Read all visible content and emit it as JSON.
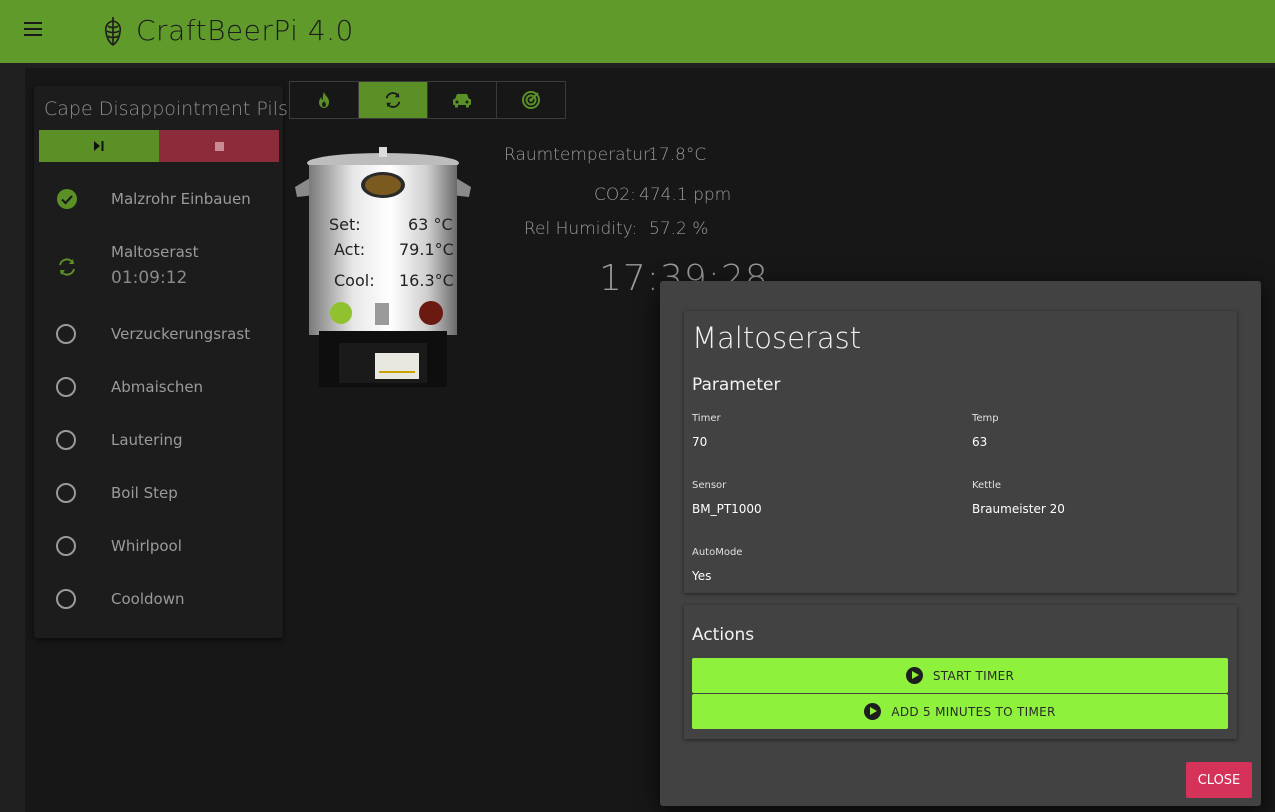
{
  "app": {
    "title": "CraftBeerPi 4.0"
  },
  "recipe": {
    "name": "Cape Disappointment Pils"
  },
  "steps": [
    {
      "label": "Malzrohr Einbauen",
      "status": "done"
    },
    {
      "label": "Maltoserast",
      "status": "active",
      "timer": "01:09:12"
    },
    {
      "label": "Verzuckerungsrast",
      "status": "pending"
    },
    {
      "label": "Abmaischen",
      "status": "pending"
    },
    {
      "label": "Lautering",
      "status": "pending"
    },
    {
      "label": "Boil Step",
      "status": "pending"
    },
    {
      "label": "Whirlpool",
      "status": "pending"
    },
    {
      "label": "Cooldown",
      "status": "pending"
    }
  ],
  "toolbar": {
    "icons": [
      "fire-icon",
      "sync-icon",
      "car-icon",
      "radar-icon"
    ],
    "active_index": 1
  },
  "kettle": {
    "set_label": "Set:",
    "set_value": "63 °C",
    "act_label": "Act:",
    "act_value": "79.1°C",
    "cool_label": "Cool:",
    "cool_value": "16.3°C"
  },
  "sensors": {
    "room_label": "Raumtemperatur:",
    "room_value": "17.8°C",
    "co2_label": "CO2:",
    "co2_value": "474.1 ppm",
    "hum_label": "Rel Humidity:",
    "hum_value": "57.2 %",
    "clock": "17:39:28"
  },
  "modal": {
    "title": "Maltoserast",
    "parameter_title": "Parameter",
    "fields": {
      "timer_label": "Timer",
      "timer_value": "70",
      "temp_label": "Temp",
      "temp_value": "63",
      "sensor_label": "Sensor",
      "sensor_value": "BM_PT1000",
      "kettle_label": "Kettle",
      "kettle_value": "Braumeister 20",
      "automode_label": "AutoMode",
      "automode_value": "Yes"
    },
    "actions_title": "Actions",
    "start_timer": "START TIMER",
    "add_5_min": "ADD 5 MINUTES TO TIMER",
    "close": "CLOSE"
  },
  "colors": {
    "appbar": "#5f9a2b",
    "accent_green": "#8ef23c",
    "stop_red": "#8c2b3a",
    "close_red": "#d5325a"
  }
}
